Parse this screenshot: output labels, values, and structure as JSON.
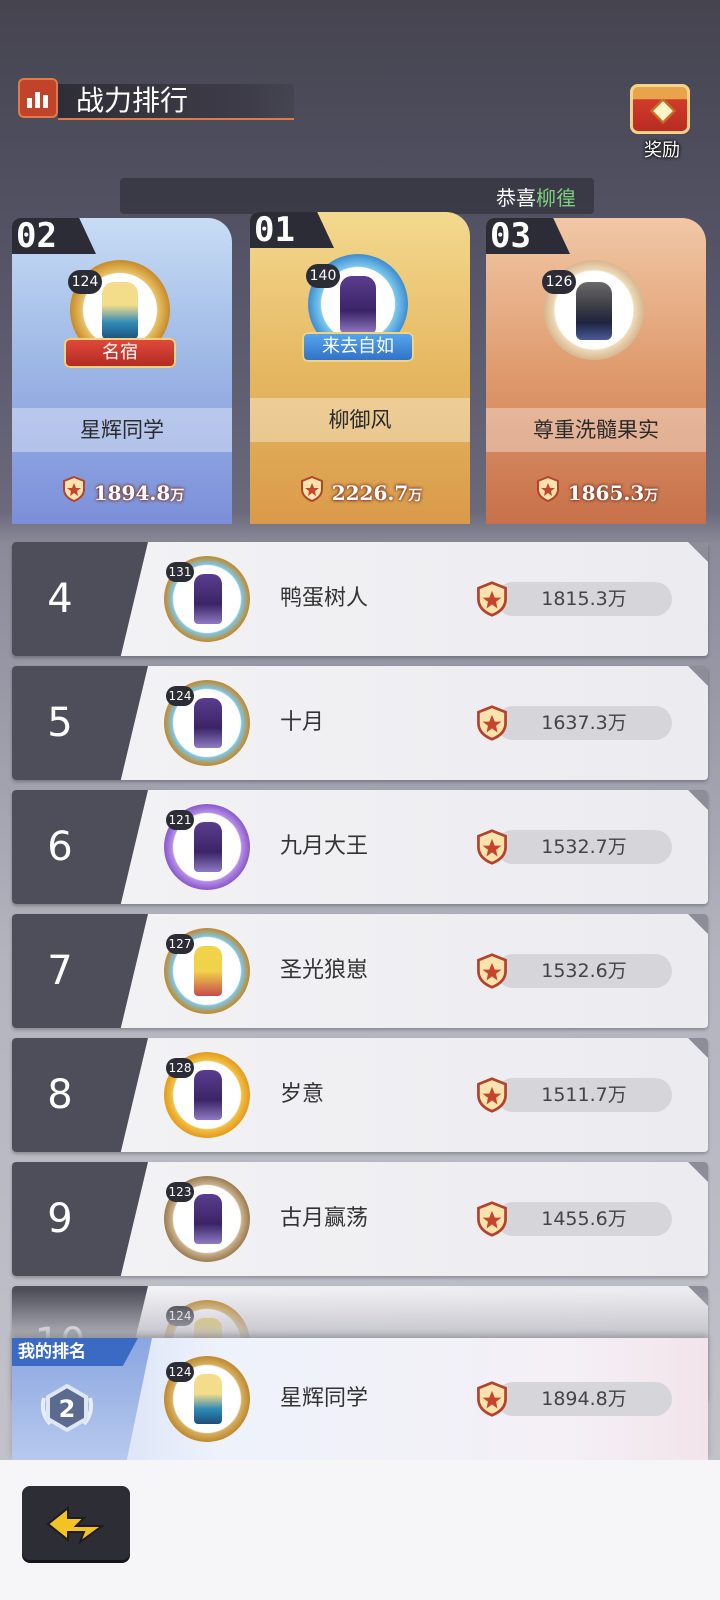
{
  "header": {
    "title": "战力排行",
    "reward_label": "奖励"
  },
  "congrats": {
    "prefix": "恭喜",
    "name": "柳徨"
  },
  "podium": [
    {
      "rank": "02",
      "level": "124",
      "name": "星辉同学",
      "power": "1894.8",
      "unit": "万",
      "badge": "名宿"
    },
    {
      "rank": "01",
      "level": "140",
      "name": "柳御风",
      "power": "2226.7",
      "unit": "万",
      "badge": "来去自如"
    },
    {
      "rank": "03",
      "level": "126",
      "name": "尊重洗髓果实",
      "power": "1865.3",
      "unit": "万",
      "badge": ""
    }
  ],
  "list": [
    {
      "rank": "4",
      "level": "131",
      "name": "鸭蛋树人",
      "power": "1815.3万"
    },
    {
      "rank": "5",
      "level": "124",
      "name": "十月",
      "power": "1637.3万"
    },
    {
      "rank": "6",
      "level": "121",
      "name": "九月大王",
      "power": "1532.7万"
    },
    {
      "rank": "7",
      "level": "127",
      "name": "圣光狼崽",
      "power": "1532.6万"
    },
    {
      "rank": "8",
      "level": "128",
      "name": "岁意",
      "power": "1511.7万"
    },
    {
      "rank": "9",
      "level": "123",
      "name": "古月赢荡",
      "power": "1455.6万"
    },
    {
      "rank": "10",
      "level": "124",
      "name": "",
      "power": ""
    }
  ],
  "mine": {
    "label": "我的排名",
    "rank_badge": "2",
    "level": "124",
    "name": "星辉同学",
    "power": "1894.8万"
  },
  "colors": {
    "accent": "#e07a4a",
    "gold": "#e6b862",
    "blue_card": "#9fb9e6",
    "bronze_card": "#df9b6d",
    "congrats_name": "#7ed07e"
  },
  "icons": {
    "title": "rank-chart-icon",
    "reward": "treasure-chest-icon",
    "power": "shield-power-icon",
    "back": "back-arrow-icon"
  }
}
